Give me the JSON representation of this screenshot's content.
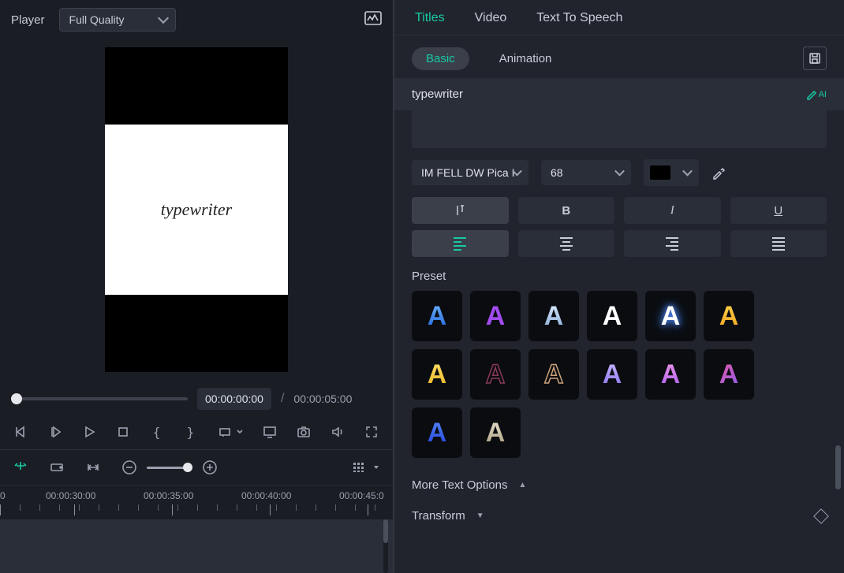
{
  "player": {
    "label": "Player",
    "quality": "Full Quality",
    "preview_text": "typewriter",
    "time_current": "00:00:00:00",
    "time_sep": "/",
    "time_total": "00:00:05:00"
  },
  "timeline": {
    "labels": [
      "0",
      "00:00:30:00",
      "00:00:35:00",
      "00:00:40:00",
      "00:00:45:0"
    ]
  },
  "panel": {
    "tabs": {
      "titles": "Titles",
      "video": "Video",
      "tts": "Text To Speech"
    },
    "subtabs": {
      "basic": "Basic",
      "animation": "Animation"
    },
    "title_value": "typewriter",
    "ai_label": "AI",
    "font": "IM FELL DW Pica I",
    "font_size": "68",
    "preset_label": "Preset",
    "more_options": "More Text Options",
    "transform": "Transform"
  },
  "presets": [
    {
      "fill": "linear-gradient(180deg,#6fb6ff,#1f5fd6)",
      "stroke": "none"
    },
    {
      "fill": "#a14bf0",
      "stroke": "none"
    },
    {
      "fill": "linear-gradient(180deg,#e6efff,#7fa8d6)",
      "stroke": "none"
    },
    {
      "fill": "#fff",
      "stroke": "none"
    },
    {
      "fill": "#fff",
      "stroke": "glow-blue"
    },
    {
      "fill": "linear-gradient(180deg,#ffd54a,#f0a020)",
      "stroke": "none"
    },
    {
      "fill": "linear-gradient(180deg,#ffe36a,#e8b020)",
      "stroke": "none"
    },
    {
      "fill": "transparent",
      "stroke": "#8a3a5a"
    },
    {
      "fill": "transparent",
      "stroke": "#c9a27a"
    },
    {
      "fill": "linear-gradient(180deg,#c9b8ff,#8a6ff0)",
      "stroke": "none"
    },
    {
      "fill": "linear-gradient(180deg,#f09ae8,#a85af0)",
      "stroke": "none"
    },
    {
      "fill": "linear-gradient(135deg,#e85aa0,#8a5af0)",
      "stroke": "none"
    },
    {
      "fill": "linear-gradient(180deg,#5a8aff,#1f3fd6)",
      "stroke": "none"
    },
    {
      "fill": "linear-gradient(180deg,#e8e2d0,#a89a7a)",
      "stroke": "none"
    }
  ]
}
